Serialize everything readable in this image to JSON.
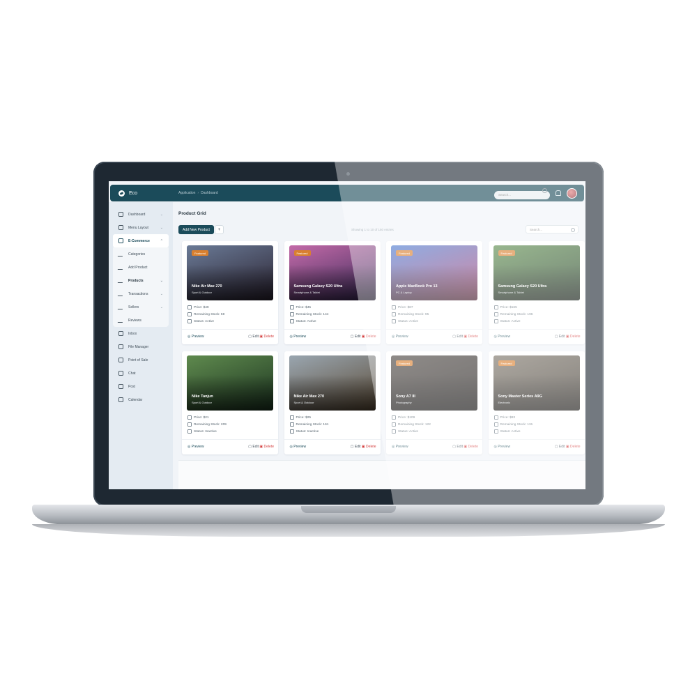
{
  "app": {
    "name": "Eco",
    "breadcrumb": [
      "Application",
      "Dashboard"
    ],
    "search_placeholder": "Search..."
  },
  "sidebar": {
    "items": [
      {
        "label": "Dashboard",
        "icon": "home-icon",
        "chevron": "⌄"
      },
      {
        "label": "Menu Layout",
        "icon": "cube-icon",
        "chevron": "⌄"
      },
      {
        "label": "E-Commerce",
        "icon": "calendar-icon",
        "chevron": "⌃"
      },
      {
        "label": "Inbox",
        "icon": "inbox-icon"
      },
      {
        "label": "File Manager",
        "icon": "folder-icon"
      },
      {
        "label": "Point of Sale",
        "icon": "card-icon"
      },
      {
        "label": "Chat",
        "icon": "chat-icon"
      },
      {
        "label": "Post",
        "icon": "file-icon"
      },
      {
        "label": "Calendar",
        "icon": "calendar-icon"
      }
    ],
    "submenu": [
      {
        "label": "Categories"
      },
      {
        "label": "Add Product"
      },
      {
        "label": "Products",
        "chevron": "⌄"
      },
      {
        "label": "Transactions",
        "chevron": "⌄"
      },
      {
        "label": "Sellers",
        "chevron": "⌄"
      },
      {
        "label": "Reviews"
      }
    ]
  },
  "main": {
    "title": "Product Grid",
    "add_button": "Add New Product",
    "plus_button": "+",
    "count_text": "Showing 1 to 10 of 150 entries",
    "search_placeholder": "Search..."
  },
  "labels": {
    "preview": "Preview",
    "edit": "Edit",
    "delete": "Delete"
  },
  "products": [
    {
      "name": "Nike Air Max 270",
      "category": "Sport & Outdoor",
      "featured": "Featured",
      "price": "Price: $49",
      "stock": "Remaining Stock: 59",
      "status": "Status: Active",
      "colors": [
        "#6a7a96",
        "#2a2230"
      ]
    },
    {
      "name": "Samsung Galaxy S20 Ultra",
      "category": "Smartphone & Tablet",
      "featured": "Featured",
      "price": "Price: $45",
      "stock": "Remaining Stock: 144",
      "status": "Status: Active",
      "colors": [
        "#c36aa8",
        "#3a2a5a"
      ]
    },
    {
      "name": "Apple MacBook Pro 13",
      "category": "PC & Laptop",
      "featured": "Featured",
      "price": "Price: $87",
      "stock": "Remaining Stock: 95",
      "status": "Status: Active",
      "colors": [
        "#4a7ad0",
        "#b43a6a"
      ]
    },
    {
      "name": "Samsung Galaxy S20 Ultra",
      "category": "Smartphone & Tablet",
      "featured": "Featured",
      "price": "Price: $165",
      "stock": "Remaining Stock: 196",
      "status": "Status: Active",
      "colors": [
        "#5a8a4a",
        "#1e3a22"
      ]
    },
    {
      "name": "Nike Tanjun",
      "category": "Sport & Outdoor",
      "featured": "",
      "price": "Price: $21",
      "stock": "Remaining Stock: 209",
      "status": "Status: Inactive",
      "colors": [
        "#5f8a4e",
        "#1b3320"
      ]
    },
    {
      "name": "Nike Air Max 270",
      "category": "Sport & Outdoor",
      "featured": "",
      "price": "Price: $25",
      "stock": "Remaining Stock: 161",
      "status": "Status: Inactive",
      "colors": [
        "#9aa6b0",
        "#5a4a36"
      ]
    },
    {
      "name": "Sony A7 III",
      "category": "Photography",
      "featured": "Featured",
      "price": "Price: $109",
      "stock": "Remaining Stock: 122",
      "status": "Status: Active",
      "colors": [
        "#4a4440",
        "#1e1a18"
      ]
    },
    {
      "name": "Sony Master Series A9G",
      "category": "Electronic",
      "featured": "Featured",
      "price": "Price: $83",
      "stock": "Remaining Stock: 115",
      "status": "Status: Active",
      "colors": [
        "#7a7266",
        "#3a342c"
      ]
    }
  ]
}
